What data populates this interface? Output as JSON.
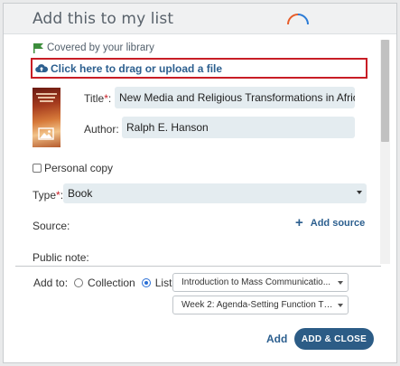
{
  "dialog": {
    "title": "Add this to my list"
  },
  "form": {
    "covered_text": "Covered by your library",
    "upload_text": "Click here to drag or upload a file",
    "title_label": "Title",
    "title_value": "New Media and Religious Transformations in Afric...",
    "author_label": "Author:",
    "author_value": "Ralph E. Hanson",
    "personal_copy_label": "Personal copy",
    "type_label": "Type",
    "type_value": "Book",
    "source_label": "Source:",
    "add_source_label": "Add source",
    "public_note_label": "Public note:",
    "required_mark": "*",
    "colon": ":"
  },
  "footer": {
    "add_to_label": "Add to:",
    "collection_label": "Collection",
    "list_label": "List",
    "list_selected": true,
    "list_value": "Introduction to Mass Communicatio...",
    "section_value": "Week 2: Agenda-Setting Function Th...",
    "add_label": "Add",
    "add_close_label": "ADD & CLOSE"
  },
  "colors": {
    "accent": "#2c5c86",
    "link": "#2c5f8f",
    "required": "#c81d25",
    "field_bg": "#e4ecf0",
    "covered_flag": "#3c8d3c"
  },
  "icons": {
    "flag": "flag-icon",
    "upload": "cloud-upload-icon",
    "add_source": "plus-icon",
    "cover_placeholder": "image-icon",
    "loading": "loading-arc-icon"
  }
}
